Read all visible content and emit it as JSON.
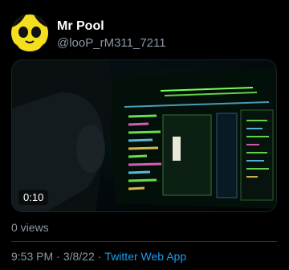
{
  "tweet": {
    "author": {
      "name": "Mr Pool",
      "handle": "@looP_rM311_7211",
      "avatar_icon": "yellow-skull-face-icon"
    },
    "media": {
      "type": "video",
      "duration": "0:10",
      "description_icon": "hacker-terminal-thumbnail"
    },
    "views": "0 views",
    "time": "9:53 PM",
    "separator": "·",
    "date": "3/8/22",
    "source": "Twitter Web App"
  },
  "colors": {
    "background": "#000000",
    "name": "#ffffff",
    "secondary_text": "#8b98a5",
    "link": "#1d9bf0",
    "avatar": "#f3df1f",
    "terminal_green": "#7dff5a",
    "terminal_cyan": "#6ad6ff"
  }
}
